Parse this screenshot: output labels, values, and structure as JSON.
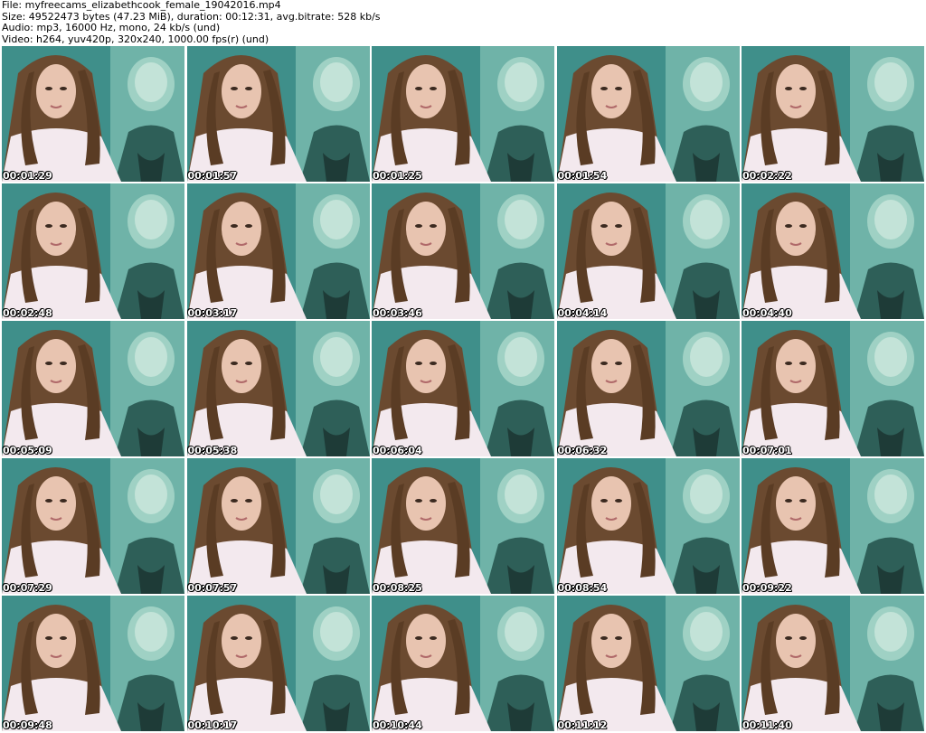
{
  "header": {
    "file_line": "File: myfreecams_elizabethcook_female_19042016.mp4",
    "size_line": "Size: 49522473 bytes (47.23 MiB), duration: 00:12:31, avg.bitrate: 528 kb/s",
    "audio_line": "Audio: mp3, 16000 Hz, mono, 24 kb/s (und)",
    "video_line": "Video: h264, yuv420p, 320x240, 1000.00 fps(r) (und)"
  },
  "thumbnails": [
    {
      "timestamp": "00:01:29"
    },
    {
      "timestamp": "00:01:57"
    },
    {
      "timestamp": "00:01:25"
    },
    {
      "timestamp": "00:01:54"
    },
    {
      "timestamp": "00:02:22"
    },
    {
      "timestamp": "00:02:48"
    },
    {
      "timestamp": "00:03:17"
    },
    {
      "timestamp": "00:03:46"
    },
    {
      "timestamp": "00:04:14"
    },
    {
      "timestamp": "00:04:40"
    },
    {
      "timestamp": "00:05:09"
    },
    {
      "timestamp": "00:05:38"
    },
    {
      "timestamp": "00:06:04"
    },
    {
      "timestamp": "00:06:32"
    },
    {
      "timestamp": "00:07:01"
    },
    {
      "timestamp": "00:07:29"
    },
    {
      "timestamp": "00:07:57"
    },
    {
      "timestamp": "00:08:25"
    },
    {
      "timestamp": "00:08:54"
    },
    {
      "timestamp": "00:09:22"
    },
    {
      "timestamp": "00:09:48"
    },
    {
      "timestamp": "00:10:17"
    },
    {
      "timestamp": "00:10:44"
    },
    {
      "timestamp": "00:11:12"
    },
    {
      "timestamp": "00:11:40"
    }
  ],
  "colors": {
    "background": "#ffffff",
    "wall": "#3f8f8a",
    "poster": "#6fb3a8",
    "hair": "#6b4a30",
    "shirt": "#f3e9ee",
    "skin": "#e8c4b0",
    "timestamp_text": "#ffffff"
  }
}
